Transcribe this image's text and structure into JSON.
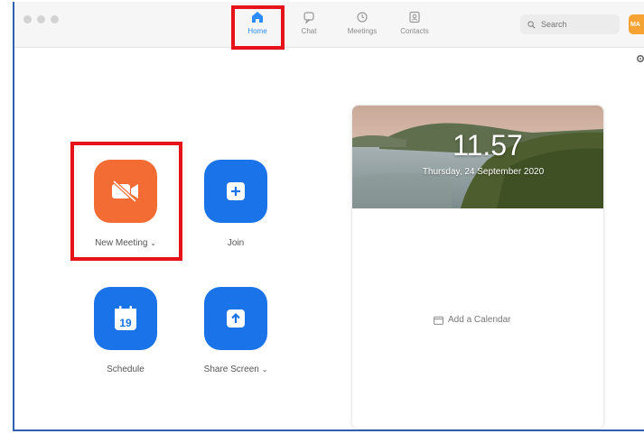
{
  "nav": {
    "tabs": [
      {
        "label": "Home",
        "active": true
      },
      {
        "label": "Chat",
        "active": false
      },
      {
        "label": "Meetings",
        "active": false
      },
      {
        "label": "Contacts",
        "active": false
      }
    ]
  },
  "search": {
    "placeholder": "Search"
  },
  "avatar": {
    "initials": "MA"
  },
  "actions": {
    "new_meeting": "New Meeting",
    "join": "Join",
    "schedule": "Schedule",
    "schedule_day": "19",
    "share_screen": "Share Screen"
  },
  "clock": {
    "time": "11.57",
    "date": "Thursday, 24 September 2020"
  },
  "calendar": {
    "add_label": "Add a Calendar"
  },
  "colors": {
    "accent": "#2d8cff",
    "new_meeting_tile": "#f36c33",
    "action_tile": "#1a73e8",
    "highlight": "#e8121a"
  }
}
